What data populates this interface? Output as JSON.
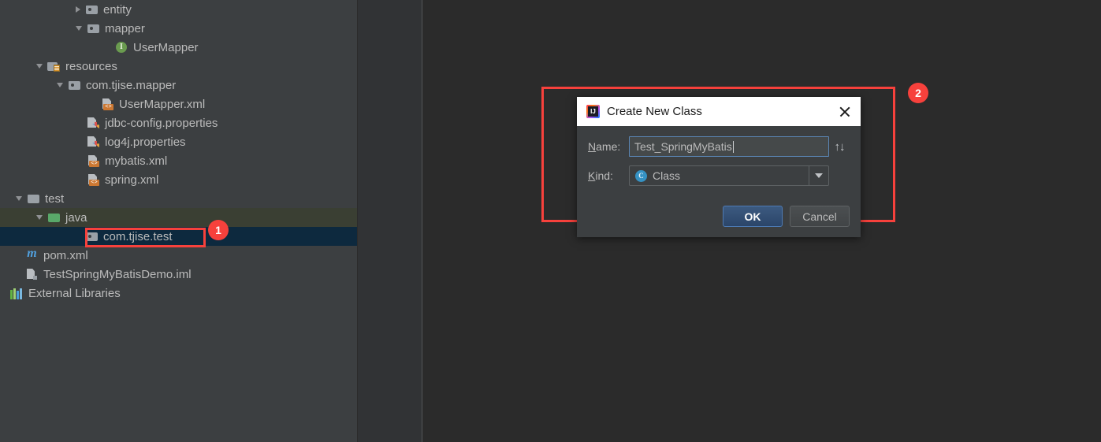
{
  "app": {
    "theme_bg": "#2b2b2b",
    "tree_bg": "#3c3f41",
    "accent_red": "#f7413c",
    "selection_blue": "#0d293e",
    "selection_green": "#3a3f33"
  },
  "project_tree": {
    "items": [
      {
        "label": "entity",
        "indent": 96,
        "toggle": "right",
        "icon": "package-folder-icon"
      },
      {
        "label": "mapper",
        "indent": 96,
        "toggle": "down",
        "icon": "package-folder-icon"
      },
      {
        "label": "UserMapper",
        "indent": 134,
        "toggle": "none",
        "icon": "interface-icon"
      },
      {
        "label": "resources",
        "indent": 46,
        "toggle": "down",
        "icon": "resources-folder-icon"
      },
      {
        "label": "com.tjise.mapper",
        "indent": 72,
        "toggle": "down",
        "icon": "package-folder-icon"
      },
      {
        "label": "UserMapper.xml",
        "indent": 116,
        "toggle": "none",
        "icon": "xml-file-icon"
      },
      {
        "label": "jdbc-config.properties",
        "indent": 98,
        "toggle": "none",
        "icon": "properties-file-icon"
      },
      {
        "label": "log4j.properties",
        "indent": 98,
        "toggle": "none",
        "icon": "properties-file-icon"
      },
      {
        "label": "mybatis.xml",
        "indent": 98,
        "toggle": "none",
        "icon": "xml-file-icon"
      },
      {
        "label": "spring.xml",
        "indent": 98,
        "toggle": "none",
        "icon": "xml-file-icon"
      },
      {
        "label": "test",
        "indent": 20,
        "toggle": "down",
        "icon": "folder-icon"
      },
      {
        "label": "java",
        "indent": 46,
        "toggle": "down",
        "icon": "source-folder-icon",
        "highlight": "green"
      },
      {
        "label": "com.tjise.test",
        "indent": 96,
        "toggle": "none",
        "icon": "package-folder-icon",
        "highlight": "blue"
      },
      {
        "label": "pom.xml",
        "indent": 20,
        "toggle": "none",
        "icon": "maven-file-icon"
      },
      {
        "label": "TestSpringMyBatisDemo.iml",
        "indent": 20,
        "toggle": "none",
        "icon": "module-file-icon"
      },
      {
        "label": "External Libraries",
        "indent": 0,
        "toggle": "none",
        "icon": "external-libraries-icon"
      }
    ]
  },
  "annotations": {
    "marker_1": "1",
    "marker_2": "2"
  },
  "dialog": {
    "title": "Create New Class",
    "titlebar_icon": "intellij-idea-icon",
    "close_icon": "close-icon",
    "name": {
      "label": "Name:",
      "label_mnemonic": "N",
      "label_rest": "ame:",
      "value": "Test_SpringMyBatis",
      "placeholder": "",
      "sort_icon": "sort-up-down-icon"
    },
    "kind": {
      "label": "Kind:",
      "label_mnemonic": "K",
      "label_rest": "ind:",
      "selected": "Class",
      "selected_icon": "class-icon",
      "dropdown_icon": "chevron-down-icon",
      "options": [
        "Class"
      ]
    },
    "buttons": {
      "ok": "OK",
      "cancel": "Cancel"
    }
  }
}
